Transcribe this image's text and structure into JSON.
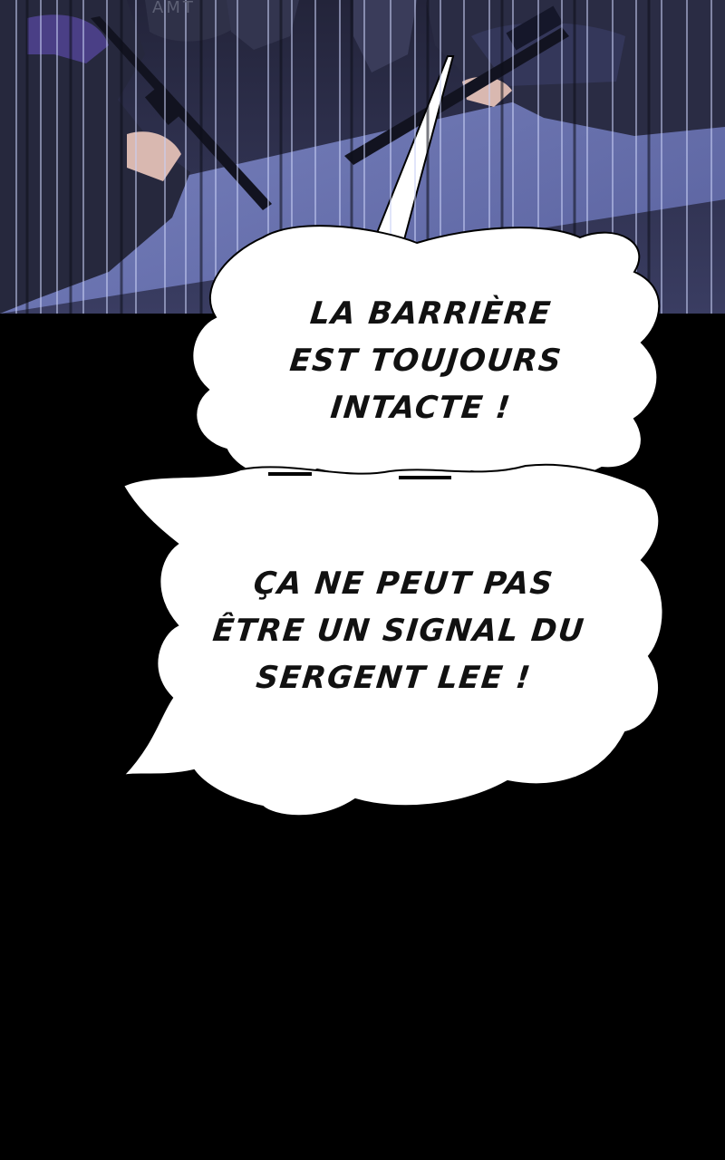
{
  "panel": {
    "watermark": "AMT",
    "colors": {
      "background": "#000000",
      "scene_base": "#2a2b45",
      "light_beam": "#7b86c8",
      "balloon_fill": "#ffffff",
      "text": "#111111"
    }
  },
  "speech_balloons": [
    {
      "lines": [
        "LA BARRIÈRE",
        "EST TOUJOURS",
        "INTACTE !"
      ]
    },
    {
      "lines": [
        "ÇA NE PEUT PAS",
        "ÊTRE UN SIGNAL DU",
        "SERGENT LEE !"
      ]
    }
  ]
}
